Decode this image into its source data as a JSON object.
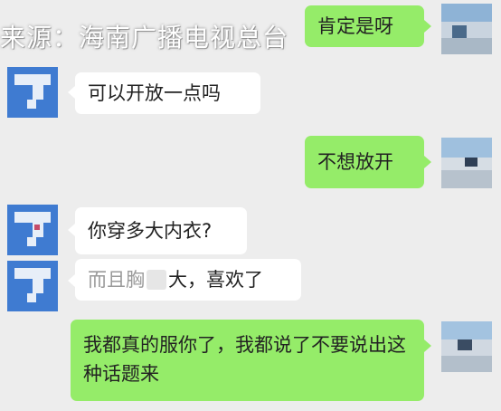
{
  "watermark": {
    "text": "来源：海南广播电视总台"
  },
  "colors": {
    "background": "#ededed",
    "incoming_bubble": "#ffffff",
    "outgoing_bubble": "#95ec69",
    "avatar_blue": "#3f7bd1"
  },
  "messages": [
    {
      "side": "right",
      "text": "肯定是呀"
    },
    {
      "side": "left",
      "text": "可以开放一点吗"
    },
    {
      "side": "right",
      "text": "不想放开"
    },
    {
      "side": "left",
      "text": "你穿多大内衣?"
    },
    {
      "side": "left",
      "text": "而且胸",
      "obscured": "大，喜欢了"
    },
    {
      "side": "right",
      "text": "我都真的服你了，我都说了不要说出这种话题来"
    }
  ]
}
